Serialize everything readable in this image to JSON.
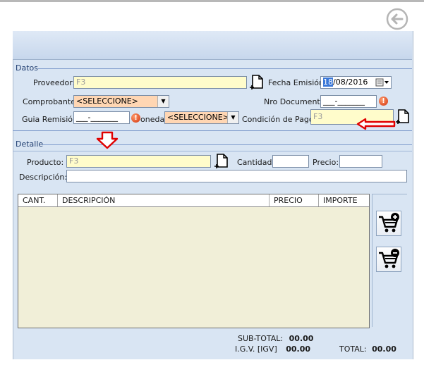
{
  "toolbar": {
    "back_icon": "back-arrow-icon"
  },
  "datos": {
    "title": "Datos",
    "proveedor": {
      "label": "Proveedor:",
      "value": "F3"
    },
    "fecha_emision": {
      "label": "Fecha Emisión:",
      "day": "18",
      "rest": "/08/2016"
    },
    "comprobante": {
      "label": "Comprobante:",
      "value": "<SELECCIONE>"
    },
    "nro_documento": {
      "label": "Nro Documento:",
      "value": "___-_______"
    },
    "guia_remision": {
      "label": "Guia Remisión:",
      "value": "___-_______"
    },
    "moneda": {
      "label": "oneda:",
      "value": "<SELECCIONE>"
    },
    "condicion_pago": {
      "label": "Condición de Pago:",
      "value": "F3"
    }
  },
  "detalle": {
    "title": "Detalle",
    "producto": {
      "label": "Producto:",
      "value": "F3"
    },
    "cantidad": {
      "label": "Cantidad:",
      "value": ""
    },
    "precio": {
      "label": "Precio:",
      "value": ""
    },
    "descripcion": {
      "label": "Descripción:",
      "value": ""
    }
  },
  "grid": {
    "columns": [
      "CANT.",
      "DESCRIPCIÓN",
      "PRECIO",
      "IMPORTE"
    ],
    "rows": []
  },
  "actions": {
    "add_icon": "cart-add-icon",
    "remove_icon": "cart-remove-icon"
  },
  "totals": {
    "subtotal_label": "SUB-TOTAL:",
    "subtotal_value": "00.00",
    "igv_label": "I.G.V. [IGV]",
    "igv_value": "00.00",
    "total_label": "TOTAL:",
    "total_value": "00.00"
  },
  "colors": {
    "panel": "#d9e5f3",
    "readonly_field": "#fffccb",
    "select_field": "#ffd6b3",
    "annotation": "#e00000"
  }
}
